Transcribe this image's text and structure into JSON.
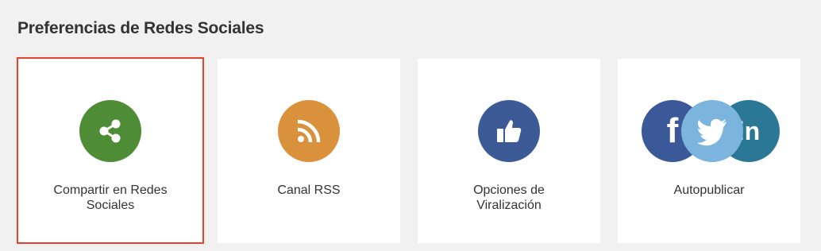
{
  "header": {
    "title": "Preferencias de Redes Sociales"
  },
  "colors": {
    "share": "#4e8d36",
    "rss": "#d9923b",
    "like": "#3c5a96",
    "facebook": "#3b5998",
    "twitter": "#7bb4dc",
    "linkedin": "#2a7896",
    "selected_border": "#e8412c"
  },
  "cards": [
    {
      "label": "Compartir en Redes Sociales",
      "icon": "share-icon",
      "selected": true
    },
    {
      "label": "Canal RSS",
      "icon": "rss-icon",
      "selected": false
    },
    {
      "label": "Opciones de Viralización",
      "icon": "thumbs-up-icon",
      "selected": false
    },
    {
      "label": "Autopublicar",
      "icons": [
        "facebook-icon",
        "twitter-icon",
        "linkedin-icon"
      ],
      "selected": false
    }
  ]
}
